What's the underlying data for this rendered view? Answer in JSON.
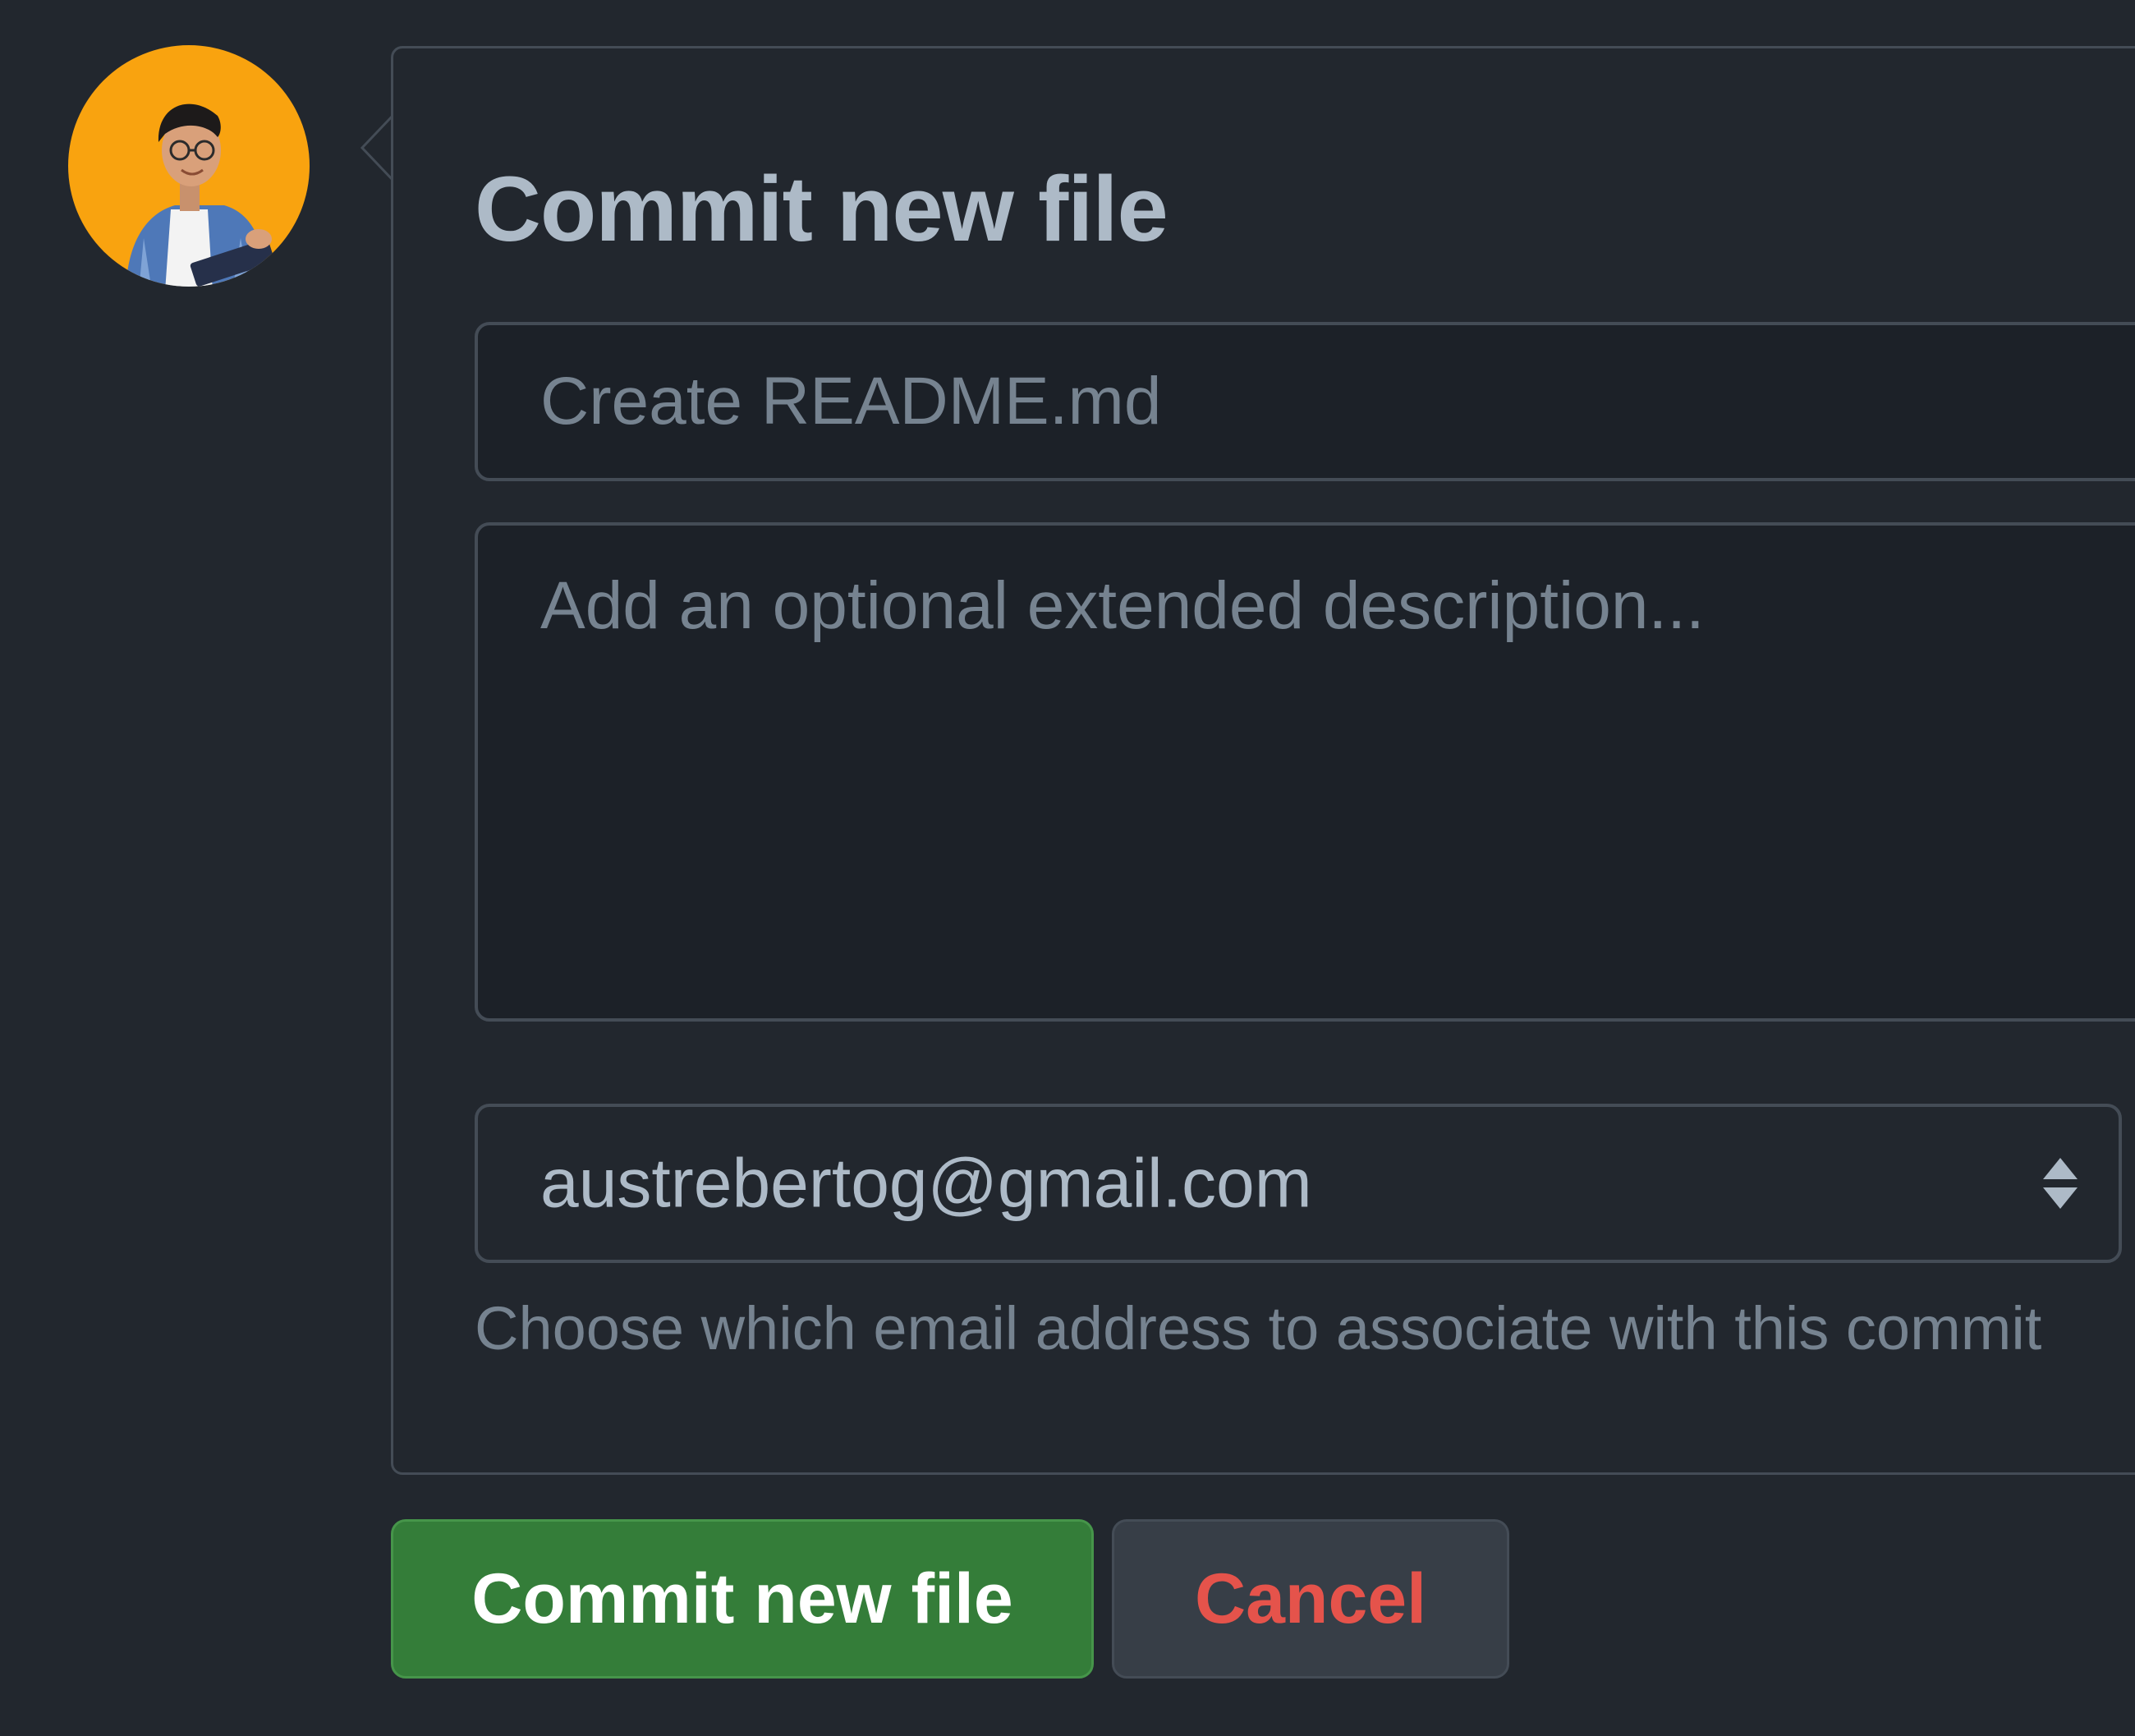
{
  "avatar": {
    "label": "user avatar",
    "background_color": "#f9a30f"
  },
  "commit_form": {
    "title": "Commit new file",
    "summary_placeholder": "Create README.md",
    "description_placeholder": "Add an optional extended description...",
    "email": {
      "selected": "austrebertog@gmail.com",
      "helper_text": "Choose which email address to associate with this commit",
      "icon": "select-arrows-icon"
    }
  },
  "actions": {
    "commit_label": "Commit new file",
    "cancel_label": "Cancel"
  },
  "colors": {
    "page_background": "#22272e",
    "input_background": "#1c2128",
    "border": "#444c56",
    "text_primary": "#adbac7",
    "text_muted": "#768390",
    "commit_button": "#347d39",
    "cancel_text": "#e5534b"
  }
}
